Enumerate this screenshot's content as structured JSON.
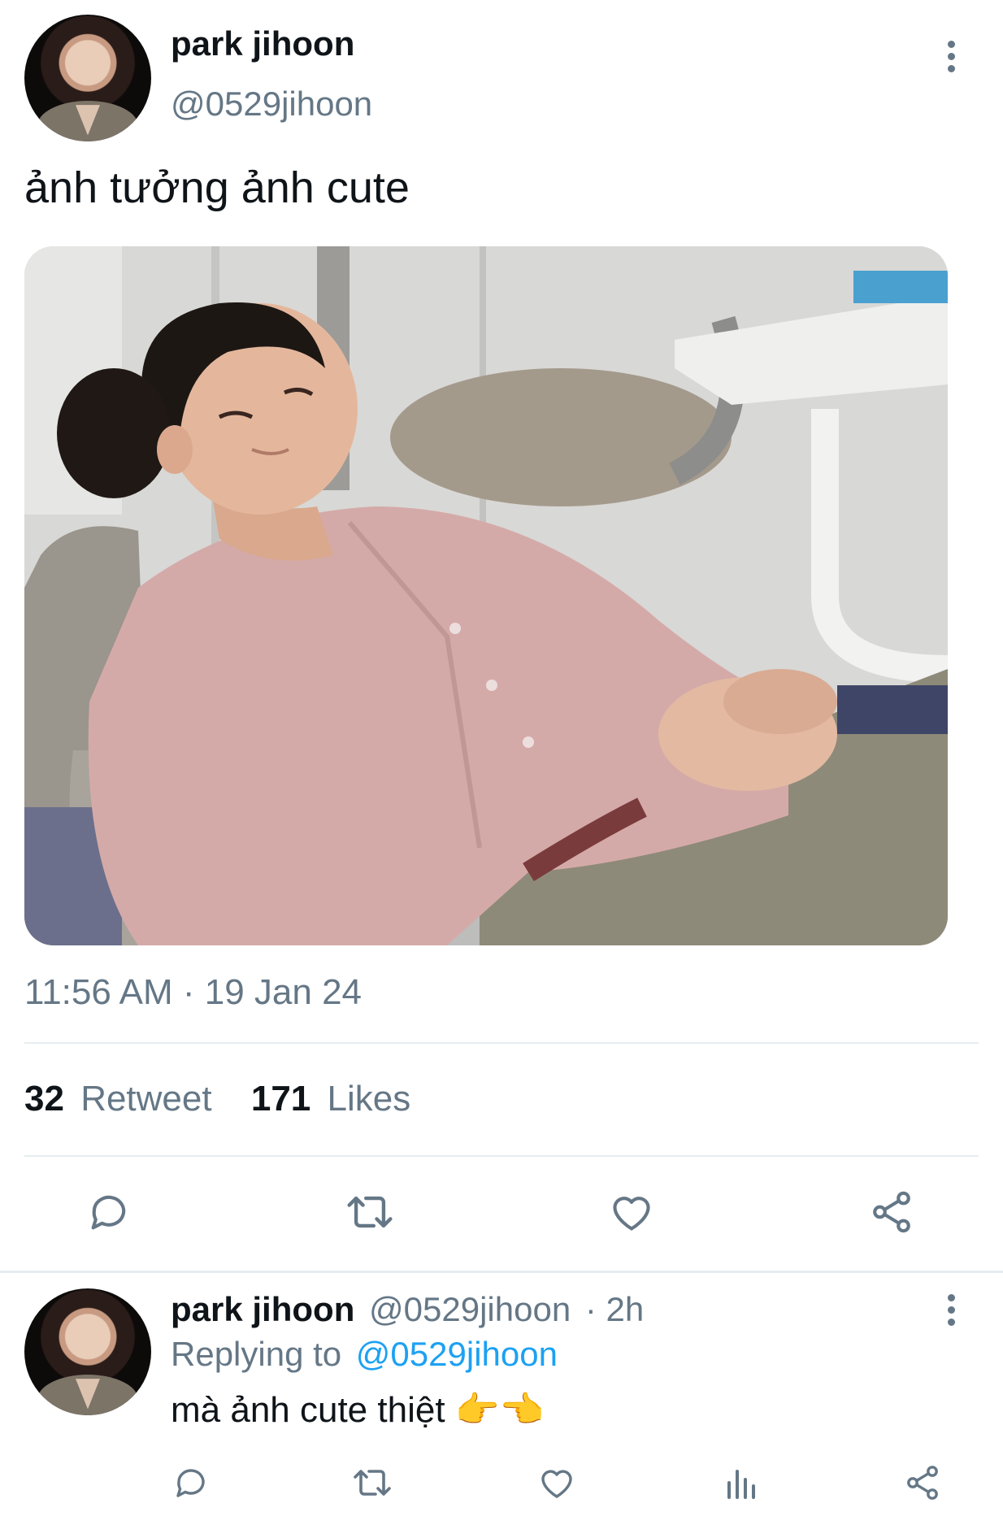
{
  "tweet": {
    "author_name": "park jihoon",
    "author_handle": "@0529jihoon",
    "text": "ảnh tưởng ảnh cute",
    "timestamp": "11:56 AM · 19 Jan 24",
    "retweet_count": "32",
    "retweet_label": "Retweet",
    "like_count": "171",
    "like_label": "Likes"
  },
  "reply": {
    "author_name": "park jihoon",
    "author_handle": "@0529jihoon",
    "time_ago": "· 2h",
    "replying_prefix": "Replying to",
    "replying_handle": "@0529jihoon",
    "text": "mà ảnh cute thiệt 👉👈"
  },
  "icons": {
    "reply": "reply-icon",
    "retweet": "retweet-icon",
    "like": "heart-icon",
    "share": "share-icon",
    "analytics": "analytics-icon",
    "more": "more-vertical-icon"
  },
  "colors": {
    "text": "#0f1419",
    "secondary": "#657786",
    "link": "#1da1f2",
    "divider": "#e6ecf0"
  }
}
